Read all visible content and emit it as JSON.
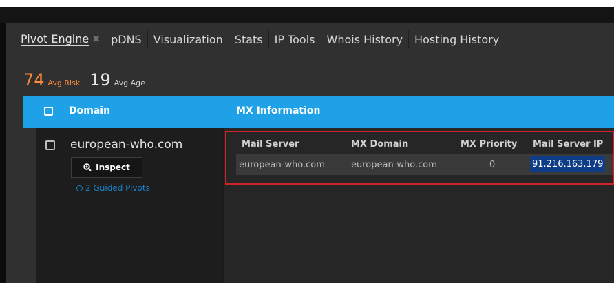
{
  "tabs": [
    {
      "label": "Pivot Engine",
      "active": true,
      "closable": true
    },
    {
      "label": "pDNS"
    },
    {
      "label": "Visualization"
    },
    {
      "label": "Stats"
    },
    {
      "label": "IP Tools"
    },
    {
      "label": "Whois History"
    },
    {
      "label": "Hosting History"
    }
  ],
  "stats": {
    "avg_risk_value": "74",
    "avg_risk_label": "Avg Risk",
    "avg_age_value": "19",
    "avg_age_label": "Avg Age",
    "risk_color": "#ff8a3c"
  },
  "table": {
    "header_color": "#1ea1e6",
    "columns": [
      "Domain",
      "MX Information"
    ],
    "rows": [
      {
        "domain": "european-who.com",
        "inspect_label": "Inspect",
        "guided_pivots": "2 Guided Pivots"
      }
    ]
  },
  "mx_info": {
    "columns": [
      "Mail Server",
      "MX Domain",
      "MX Priority",
      "Mail Server IP"
    ],
    "rows": [
      {
        "mail_server": "european-who.com",
        "mx_domain": "european-who.com",
        "priority": "0",
        "ip": "91.216.163.179"
      }
    ],
    "highlight_color": "#d1212b"
  },
  "icons": {
    "tab_close": "close-icon",
    "inspect": "magnifier-plus-icon",
    "pivots": "pivot-icon"
  }
}
